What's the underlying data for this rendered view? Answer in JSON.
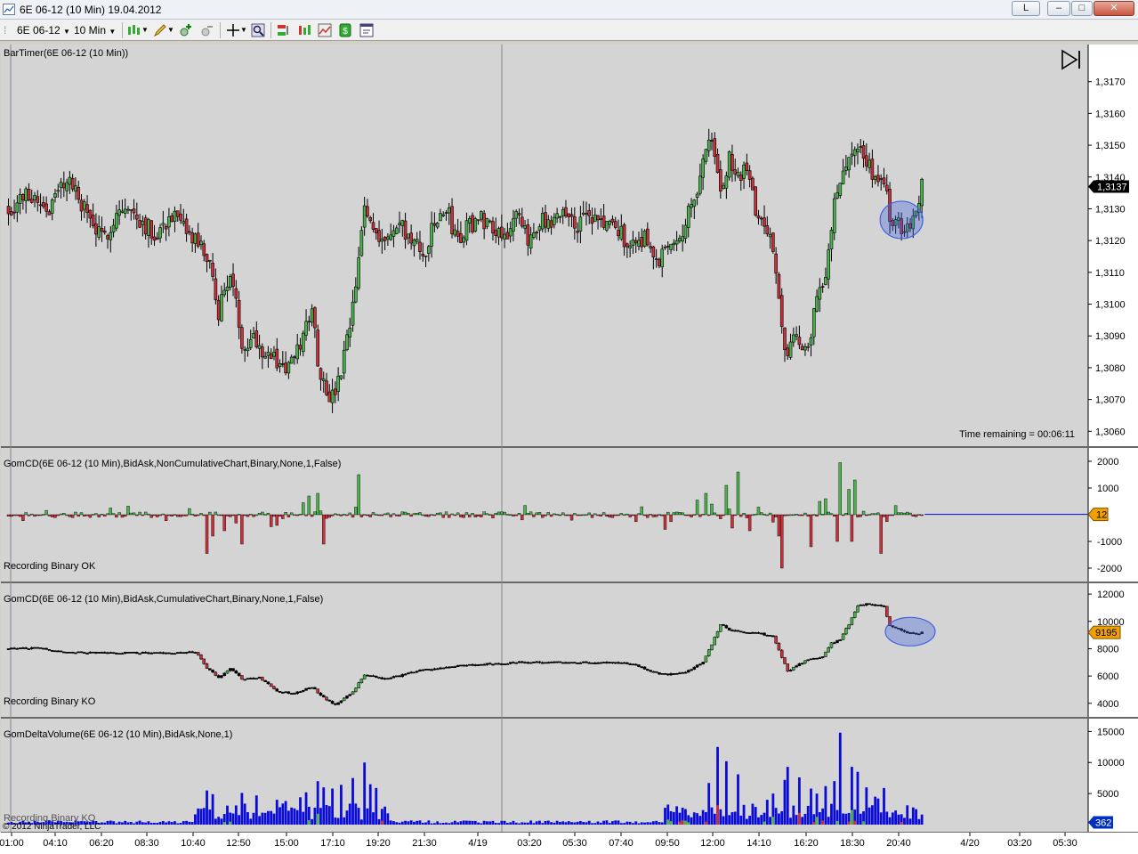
{
  "window": {
    "title": "6E 06-12 (10 Min)  19.04.2012",
    "btn_l": "L",
    "btn_min": "–",
    "btn_max": "□",
    "btn_close": "✕"
  },
  "toolbar": {
    "instrument": "6E 06-12",
    "interval": "10 Min",
    "icons": [
      "bar-style-icon",
      "draw-tool-icon",
      "zoom-in-icon",
      "zoom-out-icon",
      "crosshair-icon",
      "magnifier-icon",
      "order-entry-icon",
      "data-series-icon",
      "indicators-icon",
      "strategies-icon",
      "properties-icon"
    ]
  },
  "colors": {
    "panel_bg": "#d4d4d4",
    "up": "#49b449",
    "down": "#c8303a",
    "vol": "#0b0bd8",
    "zero_line": "#0000ff",
    "marker_fill": "#f0a000",
    "marker_last": "#0030c0",
    "highlight": "#4060e0"
  },
  "labels": {
    "price_title": "BarTimer(6E 06-12 (10 Min))",
    "time_remaining": "Time remaining = 00:06:11",
    "gom_nc_title": "GomCD(6E 06-12 (10 Min),BidAsk,NonCumulativeChart,Binary,None,1,False)",
    "gom_nc_status": "Recording Binary OK",
    "gom_c_title": "GomCD(6E 06-12 (10 Min),BidAsk,CumulativeChart,Binary,None,1,False)",
    "gom_c_status": "Recording Binary KO",
    "gom_dv_title": "GomDeltaVolume(6E 06-12 (10 Min),BidAsk,None,1)",
    "gom_dv_status": "Recording Binary KO",
    "copyright": "© 2012 NinjaTrader, LLC"
  },
  "chart_data": [
    {
      "type": "candlestick",
      "title": "BarTimer(6E 06-12 (10 Min))",
      "y_ticks": [
        "1,3170",
        "1,3160",
        "1,3150",
        "1,3140",
        "1,3130",
        "1,3120",
        "1,3110",
        "1,3100",
        "1,3090",
        "1,3080",
        "1,3070",
        "1,3060"
      ],
      "ylim": [
        1.3057,
        1.318
      ],
      "last_value": "1,3137",
      "anchors_close": [
        [
          0,
          1.313
        ],
        [
          7,
          1.3135
        ],
        [
          14,
          1.313
        ],
        [
          20,
          1.314
        ],
        [
          26,
          1.313
        ],
        [
          32,
          1.312
        ],
        [
          38,
          1.313
        ],
        [
          44,
          1.3128
        ],
        [
          50,
          1.3122
        ],
        [
          56,
          1.3128
        ],
        [
          61,
          1.3122
        ],
        [
          64,
          1.312
        ],
        [
          68,
          1.3115
        ],
        [
          72,
          1.3098
        ],
        [
          76,
          1.311
        ],
        [
          80,
          1.3088
        ],
        [
          84,
          1.309
        ],
        [
          88,
          1.3085
        ],
        [
          92,
          1.3082
        ],
        [
          95,
          1.308
        ],
        [
          98,
          1.3082
        ],
        [
          101,
          1.309
        ],
        [
          104,
          1.31
        ],
        [
          106,
          1.3083
        ],
        [
          108,
          1.3075
        ],
        [
          111,
          1.307
        ],
        [
          114,
          1.3078
        ],
        [
          118,
          1.3098
        ],
        [
          122,
          1.313
        ],
        [
          126,
          1.3123
        ],
        [
          130,
          1.312
        ],
        [
          134,
          1.3125
        ],
        [
          138,
          1.312
        ],
        [
          142,
          1.3115
        ],
        [
          146,
          1.3125
        ],
        [
          150,
          1.313
        ],
        [
          154,
          1.312
        ],
        [
          158,
          1.3125
        ],
        [
          162,
          1.3127
        ],
        [
          166,
          1.3125
        ],
        [
          170,
          1.3122
        ],
        [
          174,
          1.3127
        ],
        [
          178,
          1.312
        ],
        [
          182,
          1.3127
        ],
        [
          186,
          1.3123
        ],
        [
          190,
          1.313
        ],
        [
          194,
          1.3125
        ],
        [
          198,
          1.3127
        ],
        [
          202,
          1.3126
        ],
        [
          206,
          1.3125
        ],
        [
          210,
          1.3122
        ],
        [
          214,
          1.3118
        ],
        [
          218,
          1.3122
        ],
        [
          222,
          1.3112
        ],
        [
          226,
          1.312
        ],
        [
          230,
          1.3122
        ],
        [
          234,
          1.313
        ],
        [
          238,
          1.3145
        ],
        [
          241,
          1.3152
        ],
        [
          244,
          1.3135
        ],
        [
          247,
          1.3145
        ],
        [
          250,
          1.314
        ],
        [
          253,
          1.3142
        ],
        [
          256,
          1.313
        ],
        [
          259,
          1.3125
        ],
        [
          262,
          1.3118
        ],
        [
          265,
          1.3095
        ],
        [
          267,
          1.3082
        ],
        [
          270,
          1.3092
        ],
        [
          273,
          1.3085
        ],
        [
          275,
          1.3092
        ],
        [
          277,
          1.31
        ],
        [
          280,
          1.3108
        ],
        [
          283,
          1.3135
        ],
        [
          285,
          1.314
        ],
        [
          288,
          1.3145
        ],
        [
          291,
          1.315
        ],
        [
          294,
          1.3145
        ],
        [
          297,
          1.3138
        ],
        [
          300,
          1.3138
        ],
        [
          302,
          1.3128
        ],
        [
          305,
          1.3125
        ],
        [
          308,
          1.3125
        ],
        [
          311,
          1.313
        ],
        [
          313,
          1.3137
        ]
      ],
      "volatility": 0.0005,
      "highlight_marker": "ellipse around last consolidation"
    },
    {
      "type": "bar",
      "title": "GomCD(6E 06-12 (10 Min),BidAsk,NonCumulativeChart,Binary,None,1,False)",
      "y_ticks": [
        "2000",
        "1000",
        "0",
        "-1000",
        "-2000"
      ],
      "ylim": [
        -2300,
        2300
      ],
      "last_value": "12",
      "spikes": [
        [
          120,
          1500
        ],
        [
          265,
          -2000
        ],
        [
          285,
          1950
        ],
        [
          299,
          -1450
        ],
        [
          250,
          1600
        ],
        [
          246,
          1100
        ],
        [
          290,
          1300
        ],
        [
          288,
          950
        ],
        [
          106,
          800
        ],
        [
          68,
          -1450
        ],
        [
          80,
          -1100
        ],
        [
          108,
          -1100
        ],
        [
          225,
          -550
        ],
        [
          275,
          -1200
        ],
        [
          284,
          -1000
        ],
        [
          289,
          -1000
        ],
        [
          248,
          -500
        ],
        [
          254,
          -600
        ],
        [
          70,
          -800
        ],
        [
          74,
          -600
        ],
        [
          90,
          -450
        ],
        [
          92,
          -400
        ],
        [
          103,
          700
        ],
        [
          101,
          450
        ],
        [
          236,
          550
        ],
        [
          239,
          800
        ],
        [
          241,
          400
        ],
        [
          280,
          600
        ],
        [
          278,
          500
        ],
        [
          264,
          -800
        ]
      ]
    },
    {
      "type": "line",
      "title": "GomCD(6E 06-12 (10 Min),BidAsk,CumulativeChart,Binary,None,1,False)",
      "y_ticks": [
        "12000",
        "10000",
        "8000",
        "6000",
        "4000"
      ],
      "ylim": [
        3400,
        12400
      ],
      "last_value": "9195",
      "anchors": [
        [
          0,
          8000
        ],
        [
          10,
          8050
        ],
        [
          20,
          7750
        ],
        [
          30,
          7700
        ],
        [
          45,
          7700
        ],
        [
          60,
          7700
        ],
        [
          64,
          7800
        ],
        [
          68,
          6600
        ],
        [
          72,
          5900
        ],
        [
          76,
          6600
        ],
        [
          80,
          5800
        ],
        [
          86,
          5900
        ],
        [
          92,
          4900
        ],
        [
          98,
          4700
        ],
        [
          104,
          5200
        ],
        [
          108,
          4400
        ],
        [
          112,
          3900
        ],
        [
          118,
          4800
        ],
        [
          122,
          6100
        ],
        [
          128,
          5800
        ],
        [
          134,
          6000
        ],
        [
          140,
          6400
        ],
        [
          146,
          6500
        ],
        [
          152,
          6700
        ],
        [
          158,
          6800
        ],
        [
          166,
          6900
        ],
        [
          174,
          7000
        ],
        [
          184,
          7000
        ],
        [
          194,
          7000
        ],
        [
          204,
          7000
        ],
        [
          214,
          6900
        ],
        [
          222,
          6200
        ],
        [
          226,
          6100
        ],
        [
          232,
          6300
        ],
        [
          238,
          7000
        ],
        [
          241,
          8300
        ],
        [
          244,
          9800
        ],
        [
          247,
          9400
        ],
        [
          252,
          9200
        ],
        [
          258,
          9100
        ],
        [
          262,
          8900
        ],
        [
          265,
          7400
        ],
        [
          267,
          6300
        ],
        [
          271,
          6900
        ],
        [
          275,
          7300
        ],
        [
          279,
          7400
        ],
        [
          282,
          8400
        ],
        [
          285,
          8700
        ],
        [
          288,
          9800
        ],
        [
          291,
          11100
        ],
        [
          294,
          11300
        ],
        [
          297,
          11200
        ],
        [
          300,
          11100
        ],
        [
          302,
          9700
        ],
        [
          305,
          9400
        ],
        [
          308,
          9150
        ],
        [
          311,
          9100
        ],
        [
          313,
          9195
        ]
      ]
    },
    {
      "type": "bar",
      "title": "GomDeltaVolume(6E 06-12 (10 Min),BidAsk,None,1)",
      "y_ticks": [
        "15000",
        "10000",
        "5000"
      ],
      "ylim": [
        0,
        16200
      ],
      "last_value": "362",
      "spikes": [
        [
          122,
          10000
        ],
        [
          285,
          14800
        ],
        [
          243,
          12500
        ],
        [
          267,
          9300
        ],
        [
          289,
          9300
        ],
        [
          291,
          8500
        ],
        [
          271,
          7600
        ],
        [
          246,
          10200
        ],
        [
          250,
          8100
        ],
        [
          240,
          6700
        ],
        [
          280,
          6200
        ],
        [
          266,
          7200
        ],
        [
          106,
          7000
        ],
        [
          108,
          6000
        ],
        [
          111,
          5800
        ],
        [
          114,
          6400
        ],
        [
          118,
          7500
        ],
        [
          124,
          6500
        ],
        [
          126,
          5900
        ],
        [
          68,
          5500
        ],
        [
          70,
          4900
        ],
        [
          80,
          5100
        ],
        [
          85,
          4700
        ],
        [
          92,
          4000
        ],
        [
          95,
          3800
        ],
        [
          100,
          4400
        ],
        [
          102,
          5200
        ],
        [
          260,
          4000
        ],
        [
          262,
          5000
        ],
        [
          275,
          5800
        ],
        [
          277,
          5000
        ],
        [
          283,
          7000
        ],
        [
          294,
          6000
        ],
        [
          297,
          4500
        ],
        [
          300,
          5900
        ],
        [
          298,
          4200
        ]
      ],
      "x_ticks": [
        "01:00",
        "04:10",
        "06:20",
        "08:30",
        "10:40",
        "12:50",
        "15:00",
        "17:10",
        "19:20",
        "21:30",
        "4/19",
        "03:20",
        "05:30",
        "07:40",
        "09:50",
        "12:00",
        "14:10",
        "16:20",
        "18:30",
        "20:40",
        "4/20",
        "03:20",
        "05:30"
      ]
    }
  ]
}
